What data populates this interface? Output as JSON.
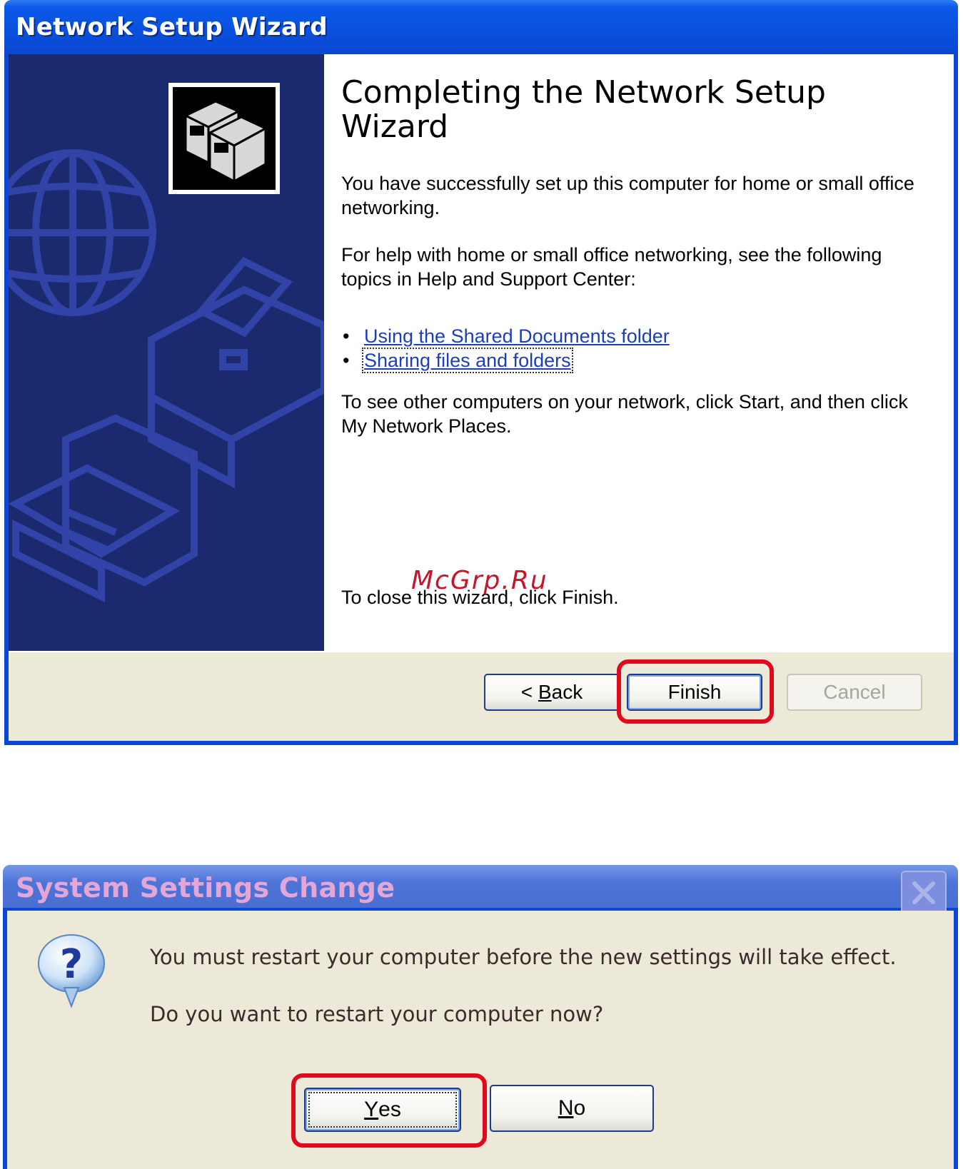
{
  "wizard": {
    "title": "Network Setup Wizard",
    "heading": "Completing the Network Setup Wizard",
    "para_success": "You have successfully set up this computer for home or small office networking.",
    "para_help": "For help with home or small office networking, see the following topics in Help and Support Center:",
    "links": [
      {
        "label": "Using the Shared Documents folder"
      },
      {
        "label": "Sharing files and folders"
      }
    ],
    "para_network": "To see other computers on your network, click Start, and then click My Network Places.",
    "para_close": "To close this wizard, click Finish.",
    "buttons": {
      "back_prefix": "< ",
      "back_mnemonic": "B",
      "back_rest": "ack",
      "finish": "Finish",
      "cancel": "Cancel"
    },
    "icons": [
      "network-computers-icon",
      "globe-graphic",
      "printer-graphic",
      "folder-graphic"
    ]
  },
  "watermark": "McGrp.Ru",
  "dialog": {
    "title": "System Settings Change",
    "message": "You must restart your computer before the new settings will take effect.",
    "question": "Do you want to restart your computer now?",
    "buttons": {
      "yes_mnemonic": "Y",
      "yes_rest": "es",
      "no_mnemonic": "N",
      "no_rest": "o"
    },
    "icons": [
      "question-icon",
      "close-icon"
    ]
  },
  "colors": {
    "xp_blue": "#0a46d8",
    "dialog_face": "#ece9d8",
    "sidebar": "#1b2a6e",
    "link": "#1c3fb8",
    "highlight_red": "#e1091e"
  }
}
